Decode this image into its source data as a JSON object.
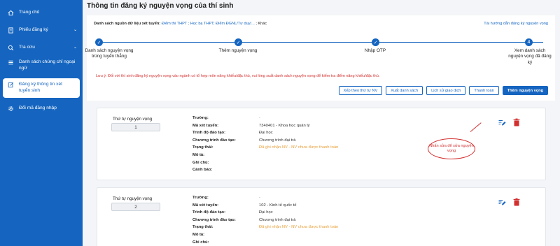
{
  "sidebar": {
    "items": [
      {
        "label": "Trang chủ",
        "icon": "home-icon"
      },
      {
        "label": "Phiếu đăng ký",
        "icon": "document-icon"
      },
      {
        "label": "Tra cứu",
        "icon": "search-icon"
      },
      {
        "label": "Danh sách chứng chỉ ngoại ngữ",
        "icon": "list-icon"
      },
      {
        "label": "Đăng ký thông tin xét tuyển sinh",
        "icon": "edit-icon"
      },
      {
        "label": "Đổi mã đăng nhập",
        "icon": "gear-icon"
      }
    ]
  },
  "page": {
    "title": "Thông tin đăng ký nguyện vọng của thí sinh"
  },
  "source": {
    "label": "Danh sách nguồn dữ liệu xét tuyển:",
    "links": "Điểm thi THPT ; Học bạ THPT; Điểm ĐGNL/Tư duy/...",
    "tail": "; Khác",
    "guide": "Tài hướng dẫn đăng ký nguyện vọng"
  },
  "steps": [
    {
      "label": "Danh sách nguyện vọng trúng tuyển thẳng",
      "mark": "✓"
    },
    {
      "label": "Thêm nguyện vọng",
      "mark": "✓"
    },
    {
      "label": "Nhập OTP",
      "mark": "✓"
    },
    {
      "label": "Xem danh sách nguyện vọng đã đăng ký",
      "mark": "4"
    }
  ],
  "note": "Lưu ý: Đối với thí sinh đăng ký nguyện vọng vào ngành có tổ hợp môn năng khiếu/đặc thù, vui lòng xuất danh sách nguyện vọng để kiểm tra điểm năng khiếu/đặc thù.",
  "buttons": {
    "sort": "Xếp theo thứ tự NV",
    "export": "Xuất danh sách",
    "history": "Lịch sử giao dịch",
    "pay": "Thanh toán",
    "add": "Thêm nguyện vọng"
  },
  "wish_labels": {
    "order": "Thứ tự nguyện vọng",
    "school": "Trường:",
    "code": "Mã xét tuyển:",
    "level": "Trình độ đào tạo:",
    "program": "Chương trình đào tạo:",
    "status": "Trạng thái:",
    "desc": "Mô tả:",
    "note": "Ghi chú:",
    "warning": "Cảnh báo:"
  },
  "wishes": [
    {
      "order": "1",
      "code": "7340401 - Khoa học quản lý",
      "level": "Đại học",
      "program": "Chương trình đại trà",
      "status": "Đã ghi nhận NV - NV chưa được thanh toán"
    },
    {
      "order": "2",
      "code": "102 - Kinh tế quốc tế",
      "level": "Đại học",
      "program": "Chương trình đại trà",
      "status": "Đã ghi nhận NV - NV chưa được thanh toán"
    }
  ],
  "callout": "Nhấn sửa để sửa nguyện vọng",
  "colors": {
    "brand": "#1565c0",
    "danger": "#d32f2f",
    "warning": "#e8a03a"
  }
}
